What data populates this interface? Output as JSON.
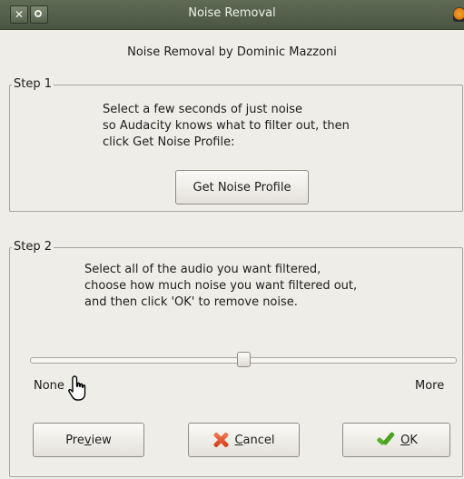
{
  "window": {
    "title": "Noise Removal"
  },
  "heading": "Noise Removal by Dominic Mazzoni",
  "step1": {
    "legend": "Step 1",
    "instructions": "Select a few seconds of just noise\nso Audacity knows what to filter out, then\nclick Get Noise Profile:",
    "button_label": "Get Noise Profile"
  },
  "step2": {
    "legend": "Step 2",
    "instructions": "Select all of the audio you want filtered,\nchoose how much noise you want filtered out,\nand then click 'OK' to remove noise.",
    "slider": {
      "min_label": "None",
      "max_label": "More",
      "value_fraction": 0.5
    }
  },
  "buttons": {
    "preview": {
      "prefix": "Pre",
      "mnemonic": "v",
      "suffix": "iew"
    },
    "cancel": {
      "prefix": "",
      "mnemonic": "C",
      "suffix": "ancel"
    },
    "ok": {
      "prefix": "",
      "mnemonic": "O",
      "suffix": "K"
    }
  },
  "icons": {
    "close": "close-icon",
    "restore": "restore-icon",
    "app": "audacity-icon",
    "cancel": "x-icon",
    "ok": "checkmark-icon",
    "cursor": "hand-cursor-icon"
  }
}
